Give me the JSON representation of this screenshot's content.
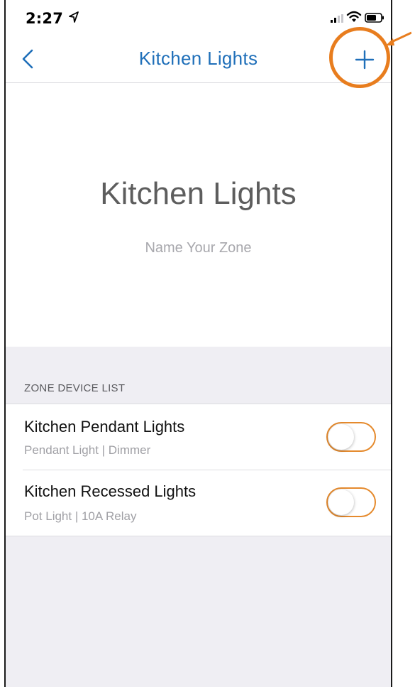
{
  "status_bar": {
    "time": "2:27"
  },
  "nav": {
    "title": "Kitchen Lights",
    "back_icon": "chevron-left-icon",
    "add_icon": "plus-icon"
  },
  "zone": {
    "name": "Kitchen Lights",
    "hint": "Name Your Zone"
  },
  "device_list": {
    "header": "ZONE DEVICE LIST",
    "items": [
      {
        "title": "Kitchen Pendant Lights",
        "subtitle": "Pendant Light | Dimmer",
        "enabled": false
      },
      {
        "title": "Kitchen Recessed Lights",
        "subtitle": "Pot Light | 10A Relay",
        "enabled": false
      }
    ]
  },
  "colors": {
    "accent": "#1f6fb9",
    "toggle_border": "#e58a2d",
    "annotation": "#e87d1e",
    "section_background": "#efeef3"
  }
}
